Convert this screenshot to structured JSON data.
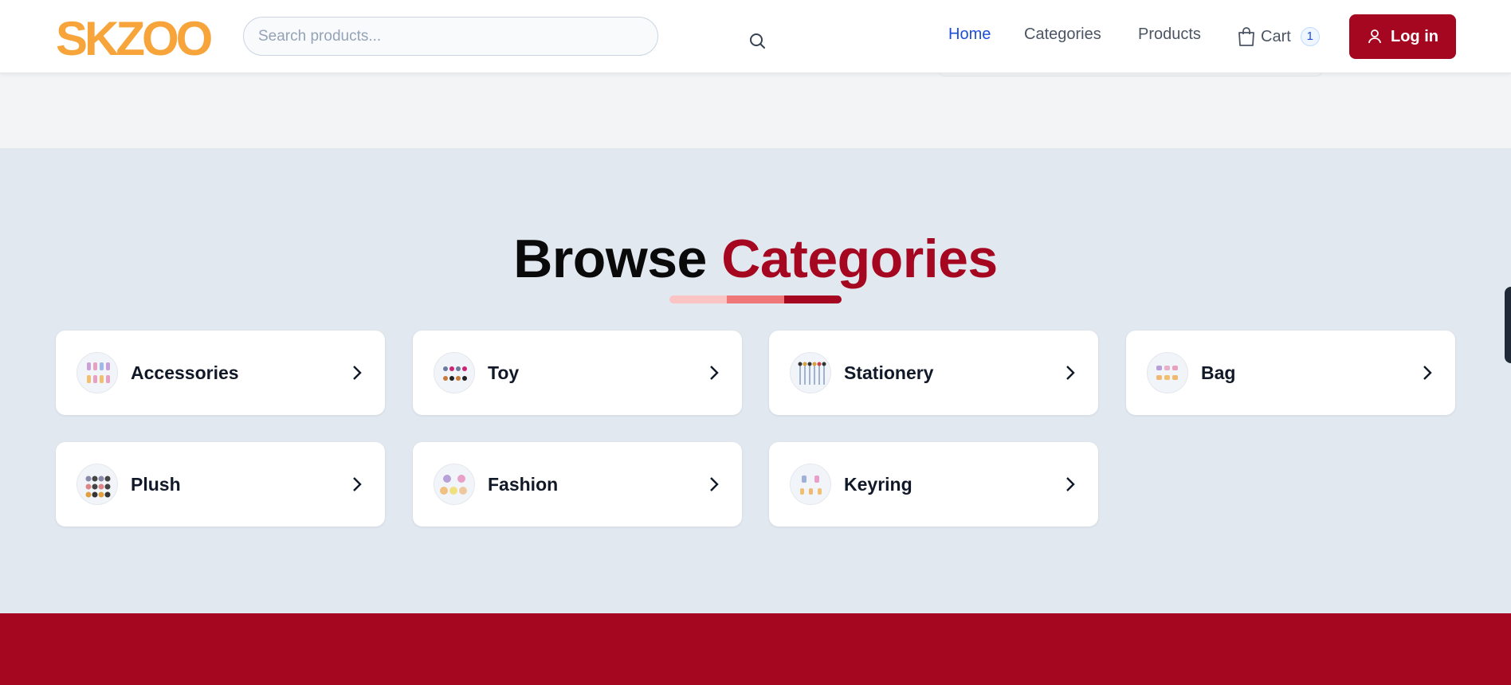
{
  "header": {
    "logo_text": "SKZOO",
    "search_placeholder": "Search products...",
    "nav": [
      {
        "label": "Home",
        "active": true
      },
      {
        "label": "Categories",
        "active": false
      },
      {
        "label": "Products",
        "active": false
      }
    ],
    "cart": {
      "label": "Cart",
      "count": "1",
      "icon": "shopping-bag-icon"
    },
    "login": {
      "label": "Log in",
      "icon": "user-icon"
    }
  },
  "categories_section": {
    "title_part1": "Browse",
    "title_part2": "Categories",
    "items": [
      {
        "label": "Accessories"
      },
      {
        "label": "Toy"
      },
      {
        "label": "Stationery"
      },
      {
        "label": "Bag"
      },
      {
        "label": "Plush"
      },
      {
        "label": "Fashion"
      },
      {
        "label": "Keyring"
      }
    ]
  },
  "colors": {
    "brand": "#a50620",
    "logo": "#f7a43a",
    "nav_active": "#1d4ed8",
    "underline": [
      "#fbc4c4",
      "#ef7777",
      "#a50620"
    ]
  }
}
